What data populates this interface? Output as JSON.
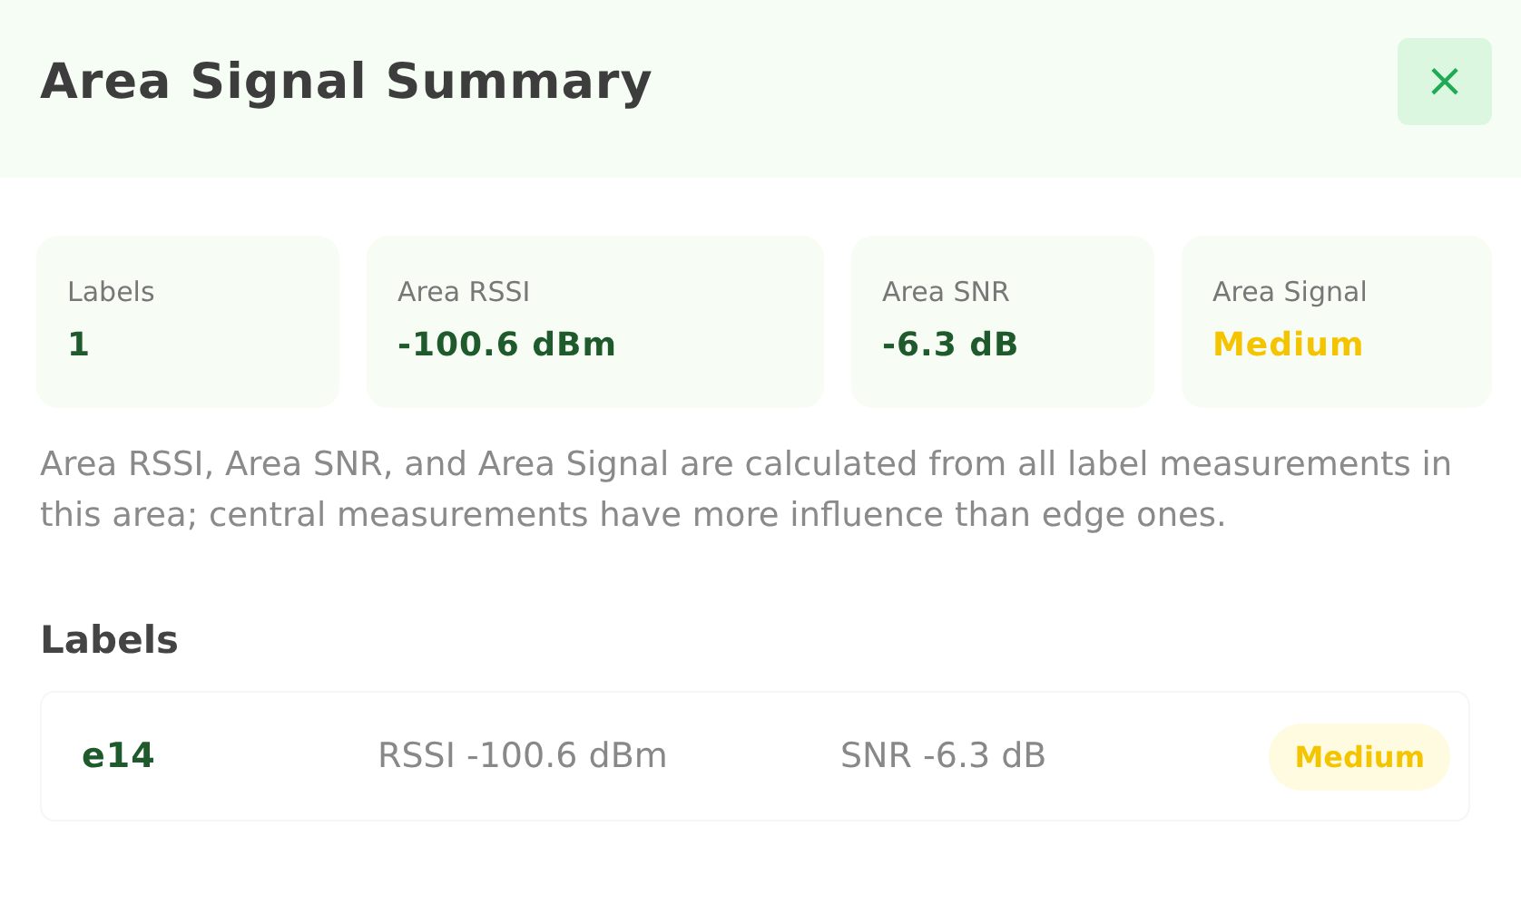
{
  "dialog": {
    "title": "Area Signal Summary",
    "close_label": "×"
  },
  "stats": [
    {
      "label": "Labels",
      "value": "1",
      "color": "#1f5a2c"
    },
    {
      "label": "Area RSSI",
      "value": "-100.6 dBm",
      "color": "#1f5a2c"
    },
    {
      "label": "Area SNR",
      "value": "-6.3 dB",
      "color": "#1f5a2c"
    },
    {
      "label": "Area Signal",
      "value": "Medium",
      "color": "#f5c400"
    }
  ],
  "description": "Area RSSI, Area SNR, and Area Signal are calculated from all label measurements in this area; central measurements have more influence than edge ones.",
  "labels_section": {
    "heading": "Labels",
    "rows": [
      {
        "name": "e14",
        "rssi": "RSSI -100.6 dBm",
        "snr": "SNR -6.3 dB",
        "signal": "Medium",
        "color": "#f5c400"
      }
    ]
  }
}
